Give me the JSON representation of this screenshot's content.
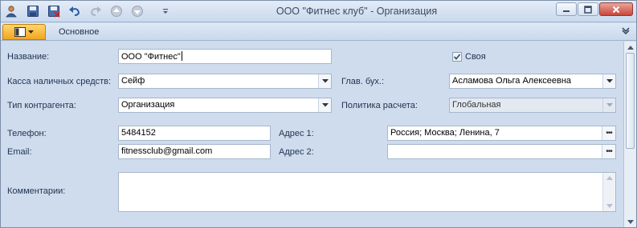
{
  "window": {
    "title": "ООО \"Фитнес клуб\" - Организация"
  },
  "quick_access": {
    "icons": [
      "user-icon",
      "save-icon",
      "save-close-icon",
      "undo-icon",
      "redo-icon",
      "up-icon",
      "down-icon",
      "customize-icon"
    ]
  },
  "ribbon": {
    "tab_main": "Основное"
  },
  "form": {
    "name": {
      "label": "Название:",
      "value": "ООО \"Фитнес\""
    },
    "own": {
      "label": "Своя",
      "checked": true
    },
    "cash": {
      "label": "Касса наличных средств:",
      "value": "Сейф"
    },
    "chief_accountant": {
      "label": "Глав. бух.:",
      "value": "Асламова Ольга Алексеевна"
    },
    "contractor_type": {
      "label": "Тип контрагента:",
      "value": "Организация"
    },
    "payment_policy": {
      "label": "Политика расчета:",
      "value": "Глобальная"
    },
    "phone": {
      "label": "Телефон:",
      "value": "5484152"
    },
    "address1": {
      "label": "Адрес 1:",
      "value": "Россия; Москва; Ленина, 7"
    },
    "email": {
      "label": "Email:",
      "value": "fitnessclub@gmail.com"
    },
    "address2": {
      "label": "Адрес 2:",
      "value": ""
    },
    "comments": {
      "label": "Комментарии:",
      "value": ""
    }
  },
  "colors": {
    "background": "#cfdced",
    "app_button": "#f2a51e",
    "close_button": "#c9463a"
  }
}
